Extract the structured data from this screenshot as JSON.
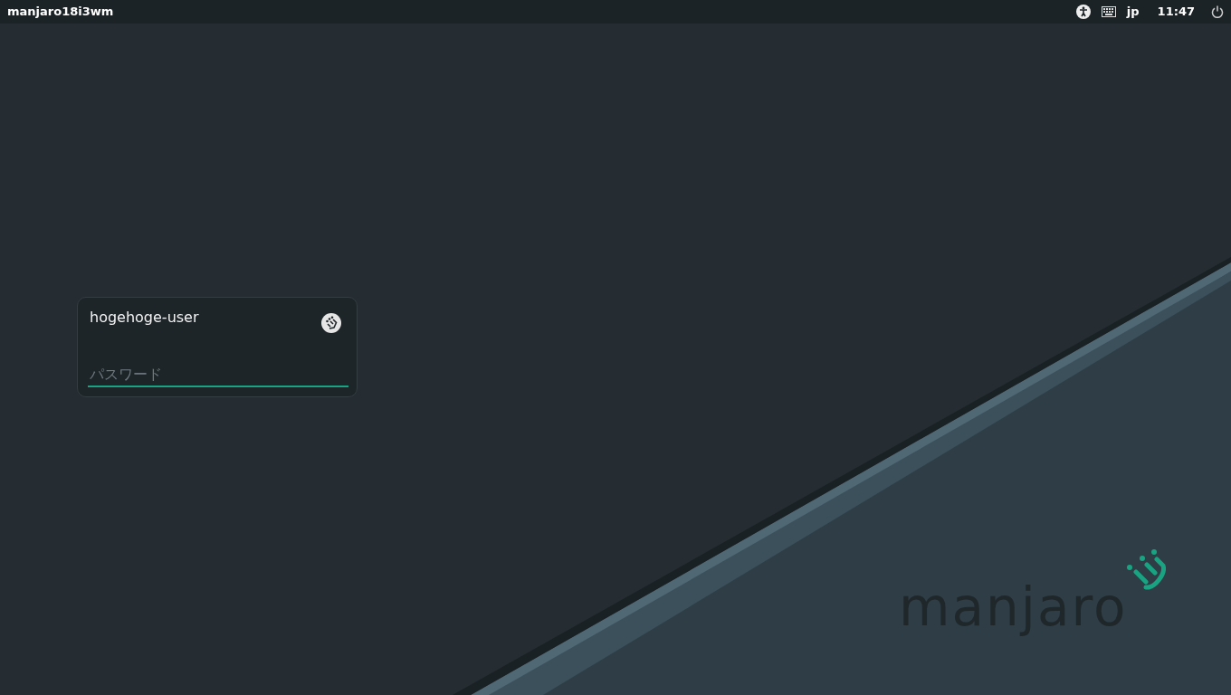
{
  "top_bar": {
    "hostname": "manjaro18i3wm",
    "keyboard_layout": "jp",
    "clock": "11:47"
  },
  "login": {
    "username": "hogehoge-user",
    "password": {
      "placeholder": "パスワード",
      "focused": true
    }
  },
  "wallpaper": {
    "logo_text": "manjaro"
  }
}
